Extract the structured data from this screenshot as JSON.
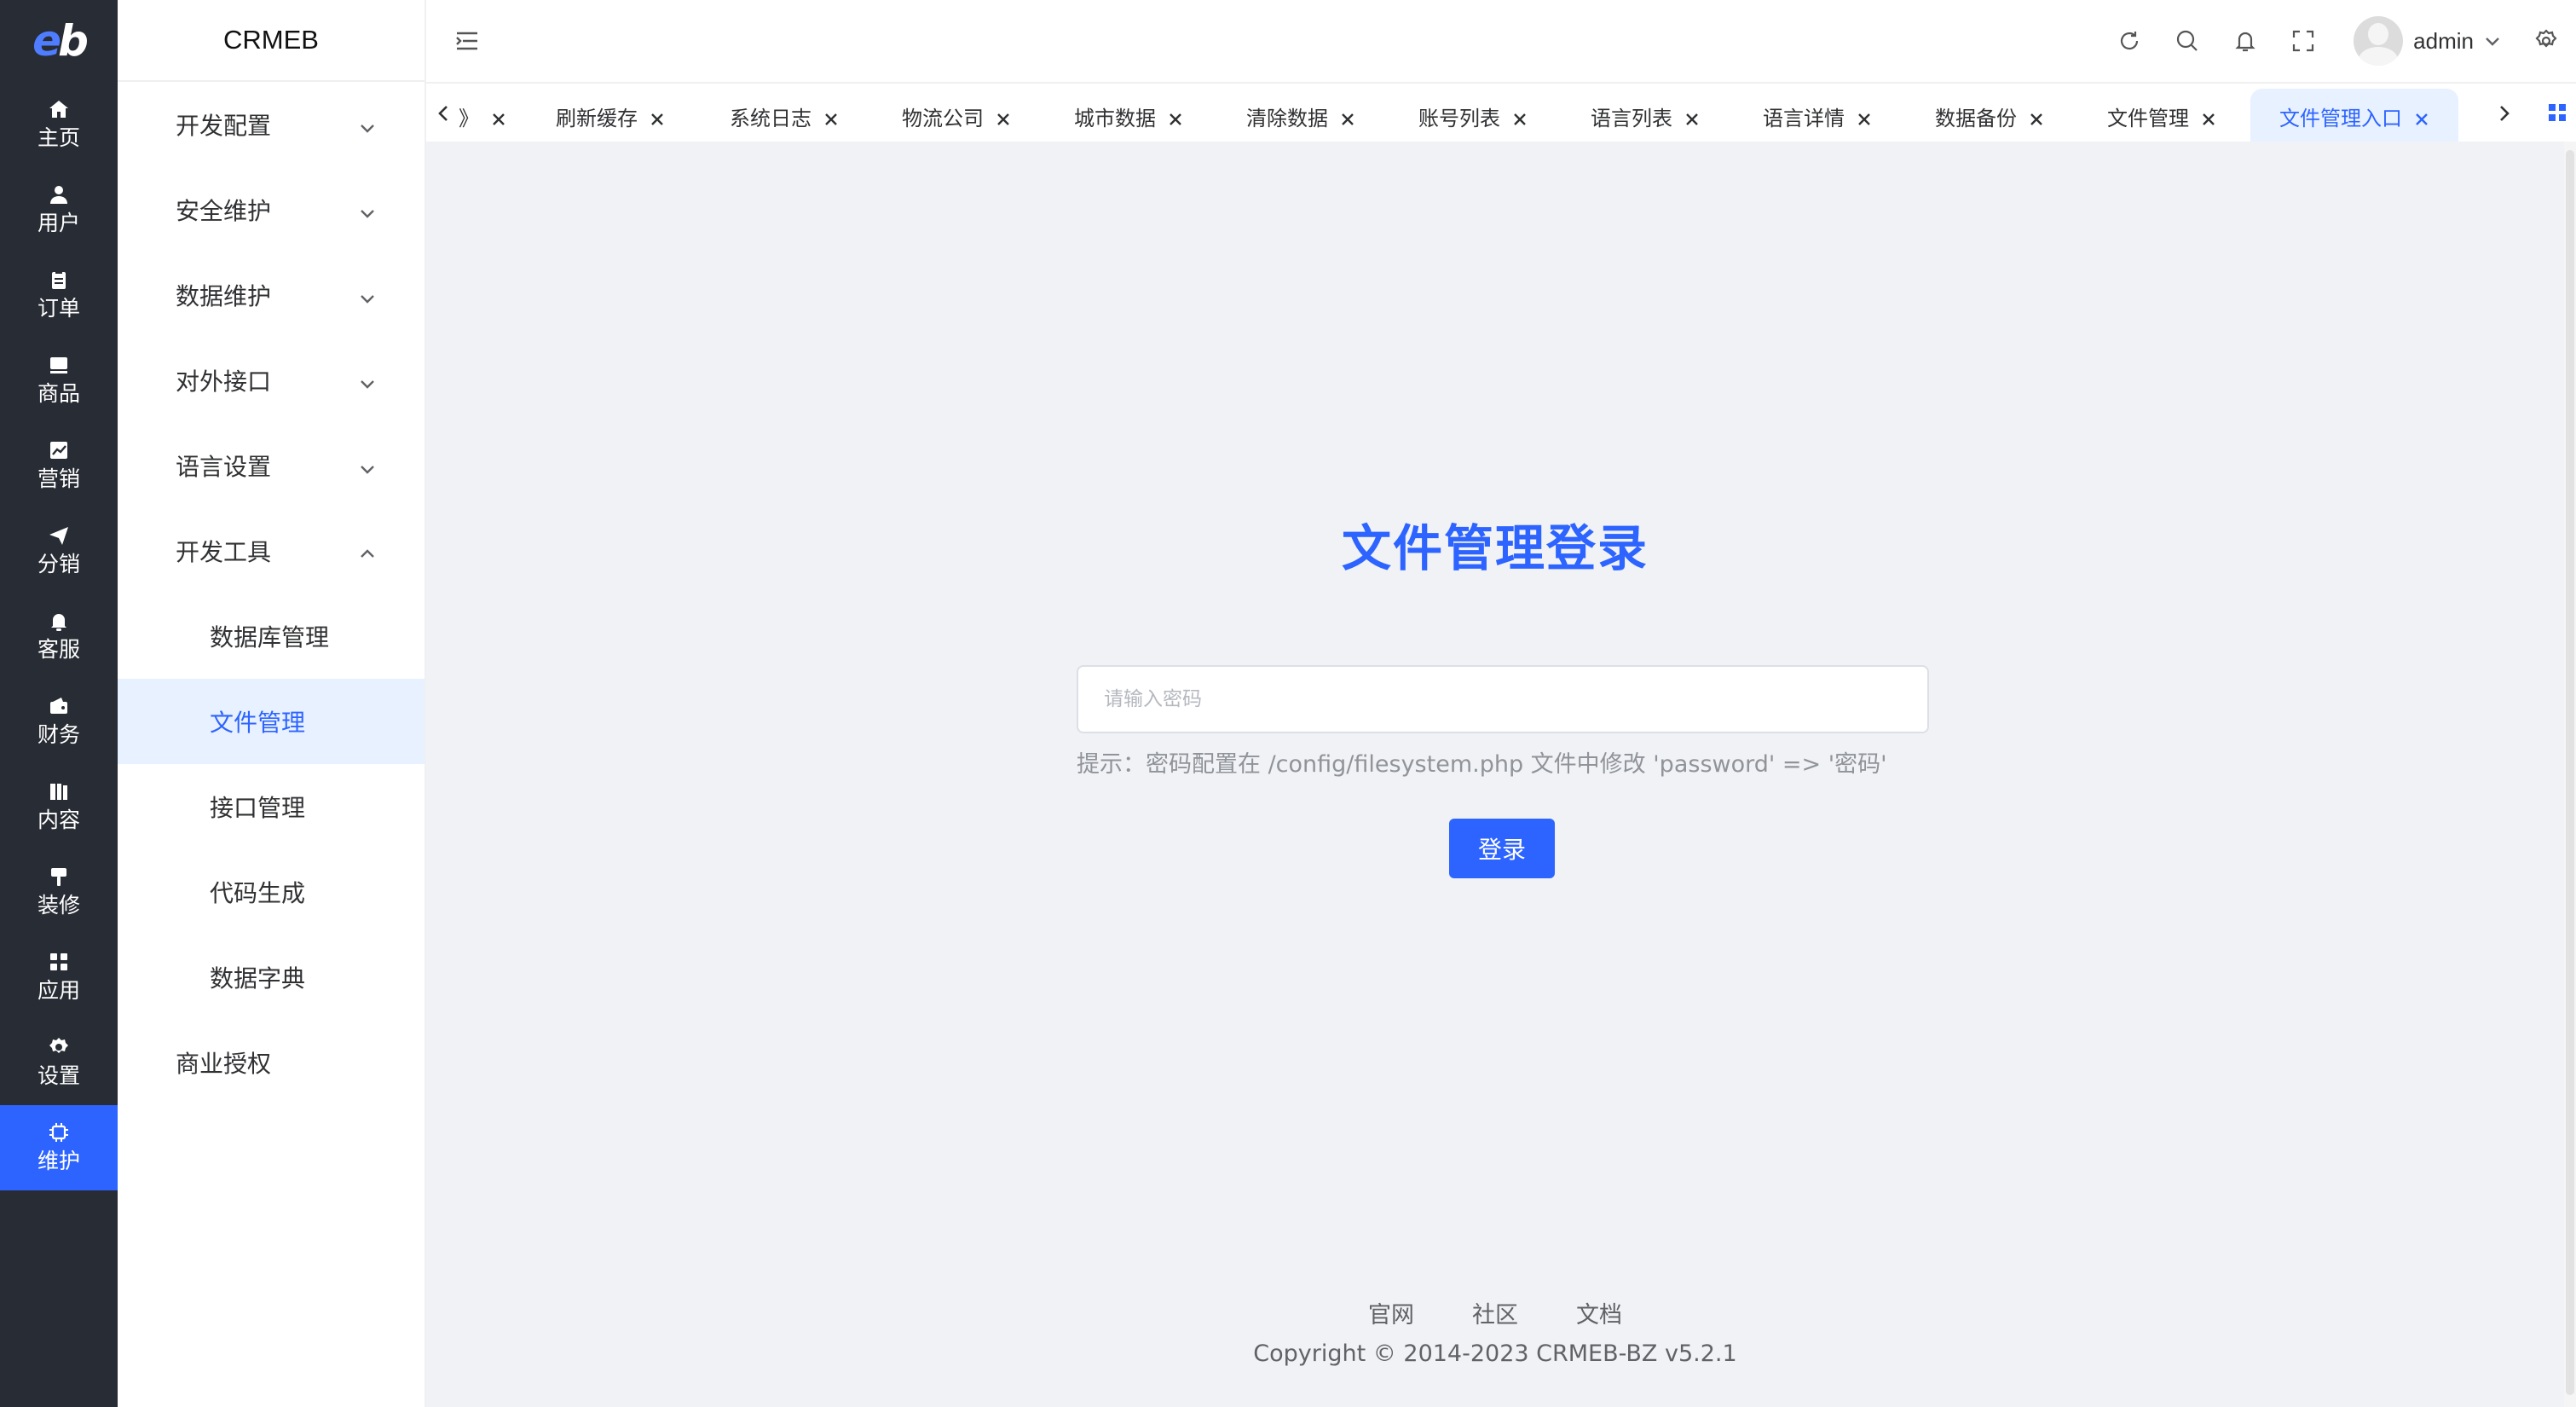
{
  "brand": {
    "logo_e": "e",
    "logo_b": "b",
    "name": "CRMEB"
  },
  "rail": [
    {
      "label": "主页",
      "icon": "home-icon"
    },
    {
      "label": "用户",
      "icon": "user-icon"
    },
    {
      "label": "订单",
      "icon": "clipboard-icon"
    },
    {
      "label": "商品",
      "icon": "shop-icon"
    },
    {
      "label": "营销",
      "icon": "chart-icon"
    },
    {
      "label": "分销",
      "icon": "send-icon"
    },
    {
      "label": "客服",
      "icon": "bell-icon"
    },
    {
      "label": "财务",
      "icon": "wallet-icon"
    },
    {
      "label": "内容",
      "icon": "book-icon"
    },
    {
      "label": "装修",
      "icon": "brush-icon"
    },
    {
      "label": "应用",
      "icon": "apps-icon"
    },
    {
      "label": "设置",
      "icon": "gear-icon"
    },
    {
      "label": "维护",
      "icon": "chip-icon",
      "active": true
    }
  ],
  "menu": {
    "groups": [
      {
        "label": "开发配置"
      },
      {
        "label": "安全维护"
      },
      {
        "label": "数据维护"
      },
      {
        "label": "对外接口"
      },
      {
        "label": "语言设置"
      },
      {
        "label": "开发工具",
        "expanded": true
      }
    ],
    "subs": [
      {
        "label": "数据库管理"
      },
      {
        "label": "文件管理",
        "active": true
      },
      {
        "label": "接口管理"
      },
      {
        "label": "代码生成"
      },
      {
        "label": "数据字典"
      }
    ],
    "tail": {
      "label": "商业授权"
    }
  },
  "header": {
    "username": "admin"
  },
  "tags": [
    {
      "label": "刷新缓存"
    },
    {
      "label": "系统日志"
    },
    {
      "label": "物流公司"
    },
    {
      "label": "城市数据"
    },
    {
      "label": "清除数据"
    },
    {
      "label": "账号列表"
    },
    {
      "label": "语言列表"
    },
    {
      "label": "语言详情"
    },
    {
      "label": "数据备份"
    },
    {
      "label": "文件管理"
    },
    {
      "label": "文件管理入口",
      "active": true
    }
  ],
  "tag_partial": "》",
  "login": {
    "title": "文件管理登录",
    "placeholder": "请输入密码",
    "hint": "提示：密码配置在 /config/filesystem.php 文件中修改 'password' => '密码'",
    "button": "登录"
  },
  "footer": {
    "links": [
      "官网",
      "社区",
      "文档"
    ],
    "copyright": "Copyright © 2014-2023 CRMEB-BZ v5.2.1"
  },
  "colors": {
    "accent": "#2d64ff",
    "rail_bg": "#282c34",
    "active_bg": "#e8f1ff"
  }
}
